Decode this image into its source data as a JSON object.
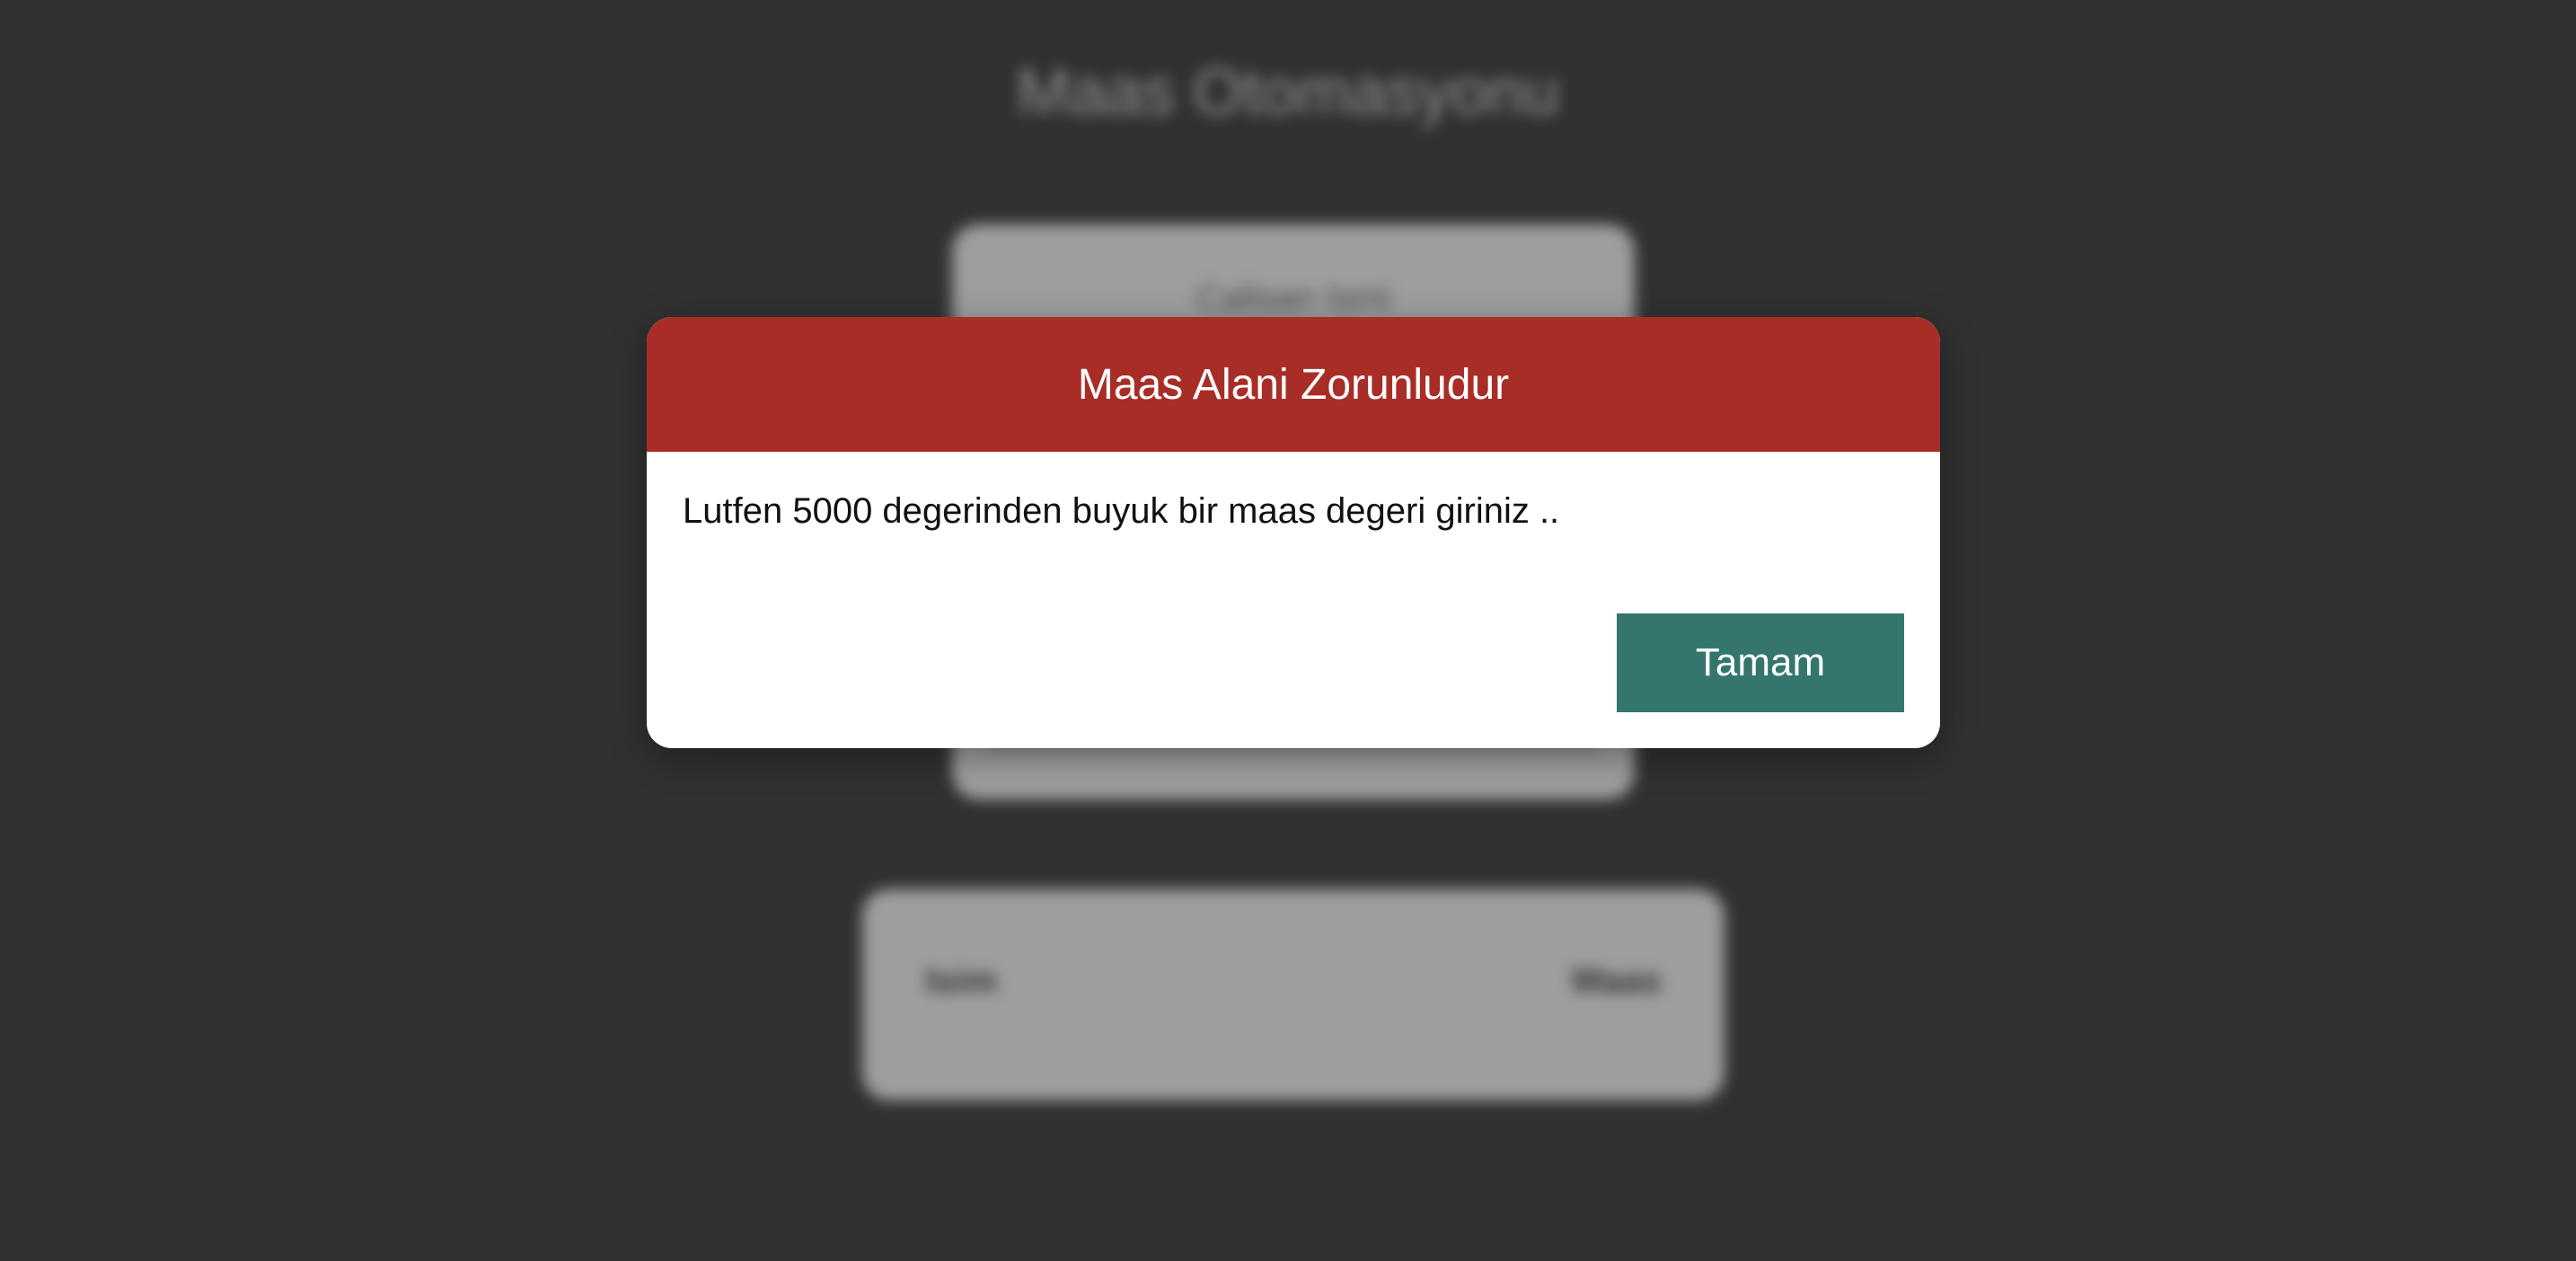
{
  "app": {
    "title": "Maas Otomasyonu",
    "form": {
      "name_label": "Calisan Ismi"
    },
    "list": {
      "col_name": "Isim",
      "col_salary": "Maas"
    }
  },
  "modal": {
    "title": "Maas Alani Zorunludur",
    "message": "Lutfen 5000 degerinden buyuk bir maas degeri giriniz ..",
    "button_label": "Tamam"
  },
  "colors": {
    "modal_header": "#a92d27",
    "button": "#34766e",
    "backdrop": "#4f4f4f"
  }
}
